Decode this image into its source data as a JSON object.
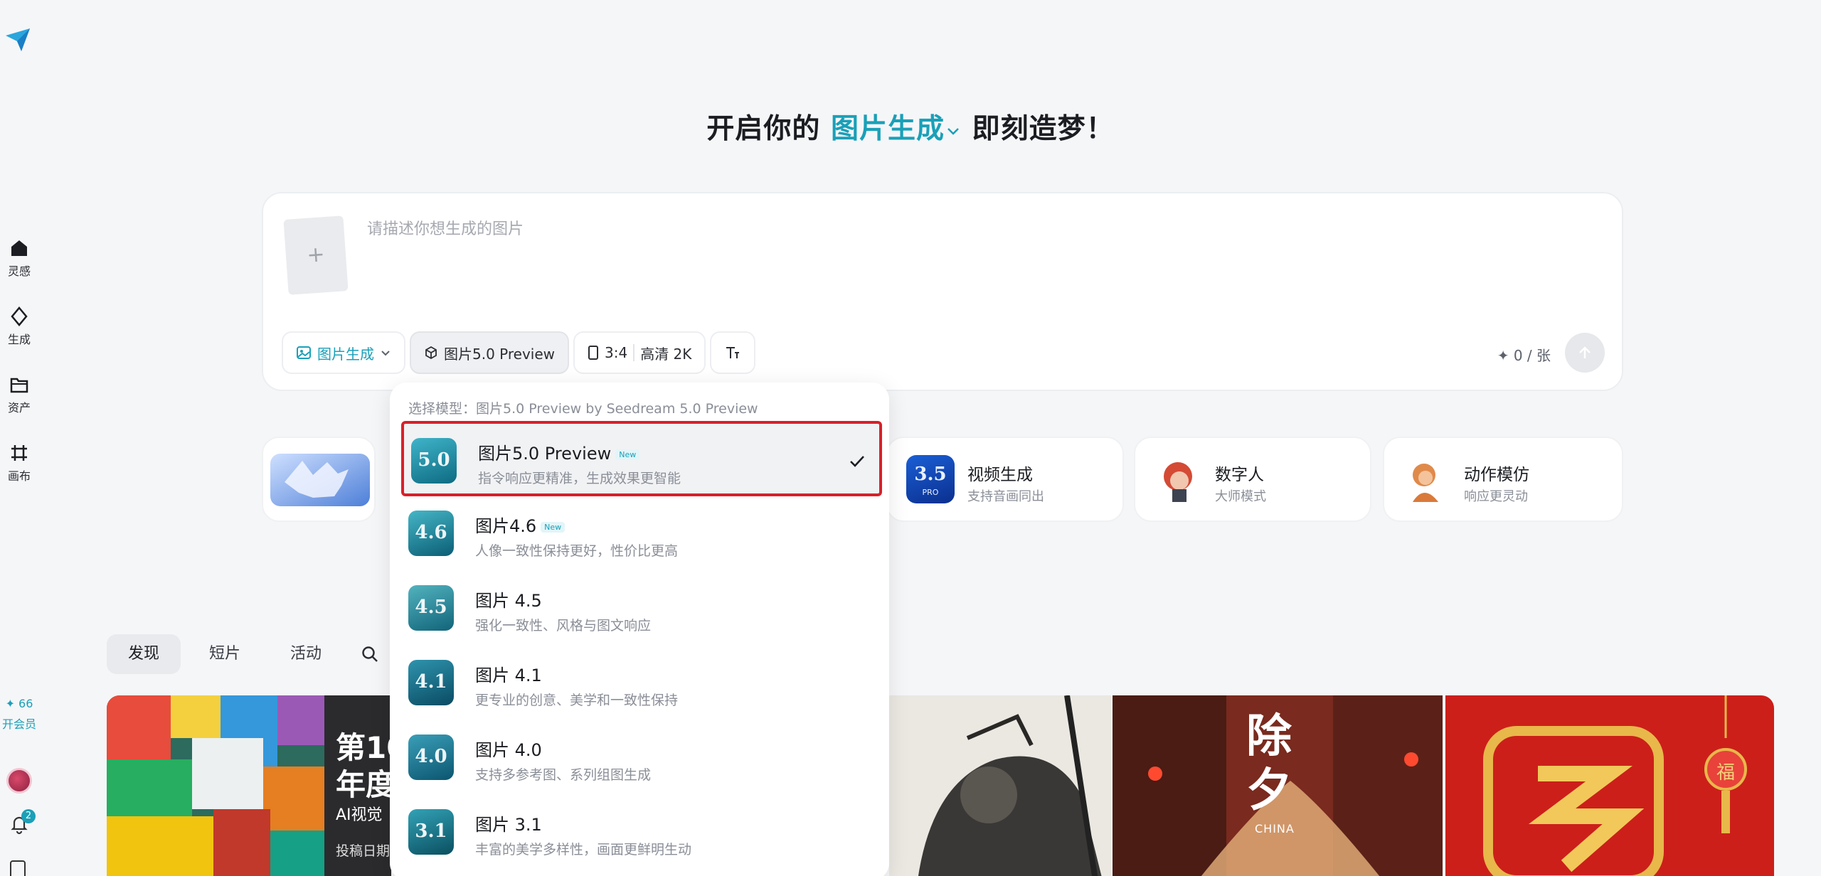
{
  "sidebar": {
    "logo": "paper-plane-logo",
    "items": [
      {
        "icon": "home-icon",
        "label": "灵感"
      },
      {
        "icon": "diamond-icon",
        "label": "生成"
      },
      {
        "icon": "folder-icon",
        "label": "资产"
      },
      {
        "icon": "canvas-icon",
        "label": "画布"
      }
    ],
    "credits": "✦ 66",
    "vip_label": "开会员",
    "notifications": "2"
  },
  "headline": {
    "prefix": "开启你的",
    "mode": "图片生成",
    "suffix": "即刻造梦！"
  },
  "prompt": {
    "placeholder": "请描述你想生成的图片",
    "upload_symbol": "+",
    "toolbar": {
      "mode_label": "图片生成",
      "model_label": "图片5.0 Preview",
      "ratio": "3:4",
      "quality": "高清 2K",
      "text_icon": "text-size-icon"
    },
    "counter": "✦ 0 / 张"
  },
  "features": [
    {
      "title": "视频生成",
      "subtitle": "支持音画同出",
      "badge": "3.5",
      "badge_sub": "PRO"
    },
    {
      "title": "数字人",
      "subtitle": "大师模式"
    },
    {
      "title": "动作模仿",
      "subtitle": "响应更灵动"
    }
  ],
  "tabs": [
    "发现",
    "短片",
    "活动"
  ],
  "gallery": {
    "poster_title_1": "第10",
    "poster_title_2": "年度",
    "poster_line_3": "AI视觉",
    "poster_line_4": "投稿日期",
    "chuxi_title": "除夕",
    "chuxi_sub": "CHINA",
    "fu": "福"
  },
  "model_dropdown": {
    "header": "选择模型：图片5.0 Preview by Seedream 5.0 Preview",
    "items": [
      {
        "name": "图片5.0 Preview",
        "badge": "New",
        "desc": "指令响应更精准，生成效果更智能",
        "ver": "5.0",
        "selected": true
      },
      {
        "name": "图片4.6",
        "badge": "New",
        "desc": "人像一致性保持更好，性价比更高",
        "ver": "4.6"
      },
      {
        "name": "图片 4.5",
        "desc": "强化一致性、风格与图文响应",
        "ver": "4.5"
      },
      {
        "name": "图片 4.1",
        "desc": "更专业的创意、美学和一致性保持",
        "ver": "4.1"
      },
      {
        "name": "图片 4.0",
        "desc": "支持多参考图、系列组图生成",
        "ver": "4.0"
      },
      {
        "name": "图片 3.1",
        "desc": "丰富的美学多样性，画面更鲜明生动",
        "ver": "3.1"
      }
    ]
  },
  "colors": {
    "accent": "#1aa0b8",
    "highlight": "#d8202a"
  }
}
